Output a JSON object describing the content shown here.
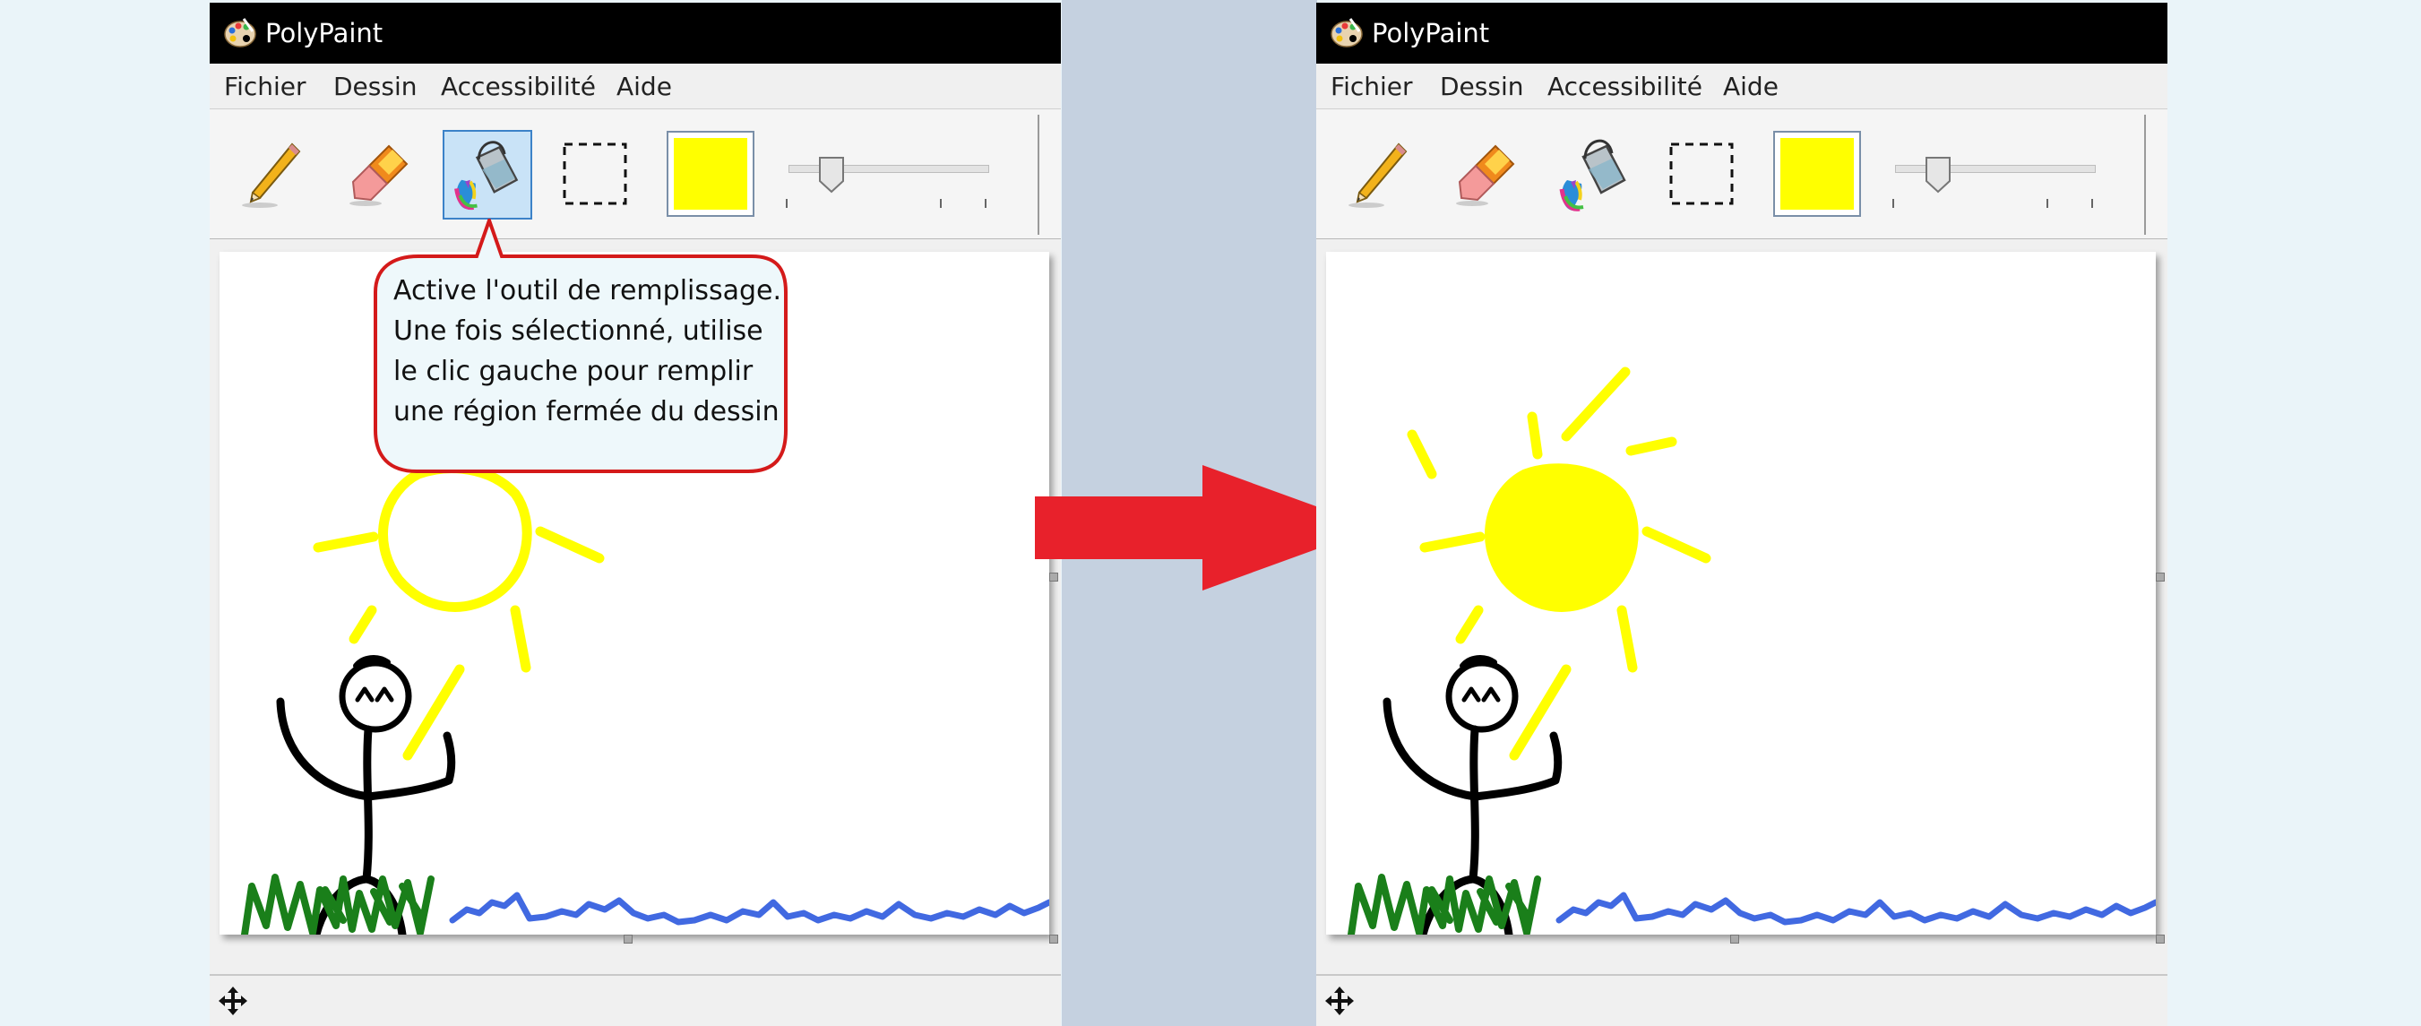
{
  "app": {
    "title": "PolyPaint"
  },
  "menu": {
    "items": [
      "Fichier",
      "Dessin",
      "Accessibilité",
      "Aide"
    ]
  },
  "toolbar": {
    "tools": [
      "pencil-tool",
      "eraser-tool",
      "fill-tool",
      "selection-tool"
    ],
    "selected_tool_left": "fill-tool",
    "selected_tool_right": "none",
    "current_color": "#ffff00"
  },
  "tooltip": {
    "lines": [
      "Active l'outil de remplissage.",
      "Une fois sélectionné, utilise",
      "le clic gauche pour remplir",
      "une région fermée du dessin"
    ]
  },
  "colors": {
    "sun": "#ffff00",
    "figure": "#000000",
    "grass": "#1a7f1a",
    "water": "#4169e1",
    "arrow": "#e8212b",
    "tooltip_border": "#d41a1a",
    "tooltip_bg": "#eef8fb"
  },
  "annotation": {
    "arrow": "before-to-after"
  }
}
